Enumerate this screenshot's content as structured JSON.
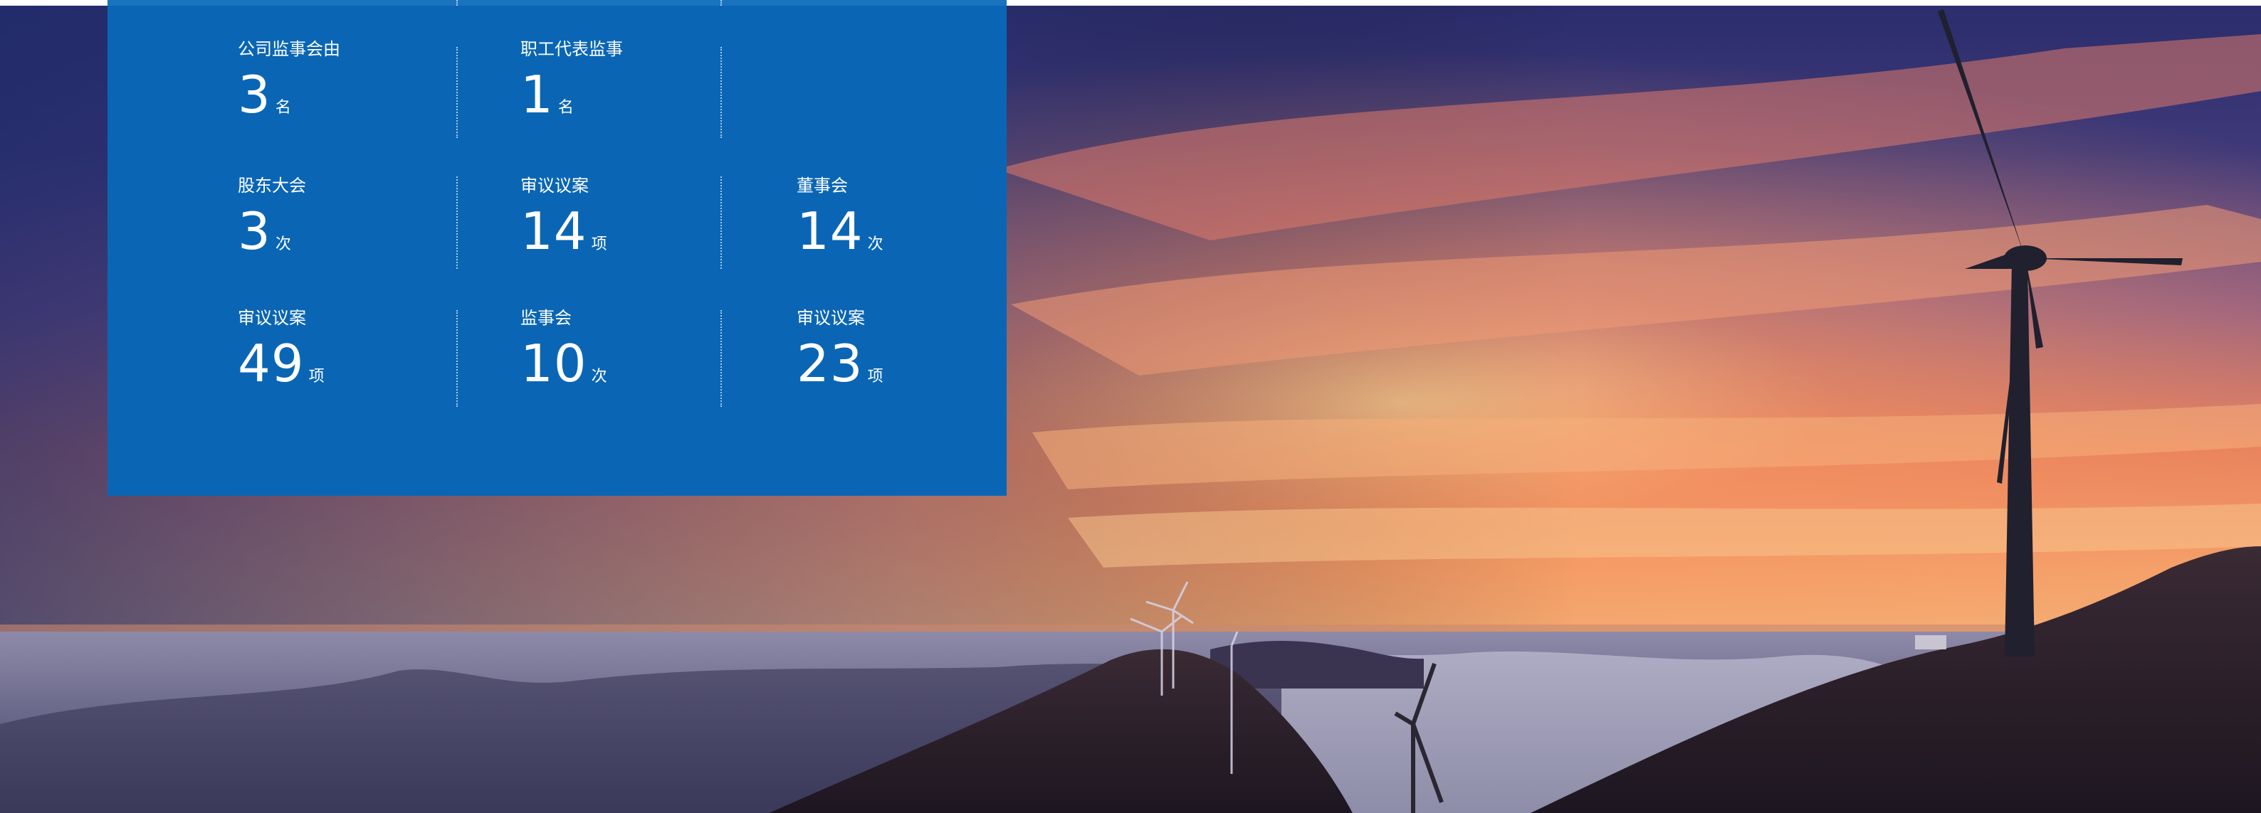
{
  "panel": {
    "stats": [
      {
        "label": "公司监事会由",
        "value": "3",
        "unit": "名"
      },
      {
        "label": "职工代表监事",
        "value": "1",
        "unit": "名"
      },
      {
        "label": "股东大会",
        "value": "3",
        "unit": "次"
      },
      {
        "label": "审议议案",
        "value": "14",
        "unit": "项"
      },
      {
        "label": "董事会",
        "value": "14",
        "unit": "次"
      },
      {
        "label": "审议议案",
        "value": "49",
        "unit": "项"
      },
      {
        "label": "监事会",
        "value": "10",
        "unit": "次"
      },
      {
        "label": "审议议案",
        "value": "23",
        "unit": "项"
      }
    ]
  },
  "colors": {
    "panel_bg": "#0a66b4",
    "sky_top": "#2c2f6b",
    "sky_glow": "#f08a5d",
    "horizon": "#f4b07a",
    "sea_of_clouds": "#6b6f93",
    "mountains": "#2a1f2a"
  },
  "background_image": {
    "subject": "wind-turbines-on-mountain-at-sunset"
  }
}
